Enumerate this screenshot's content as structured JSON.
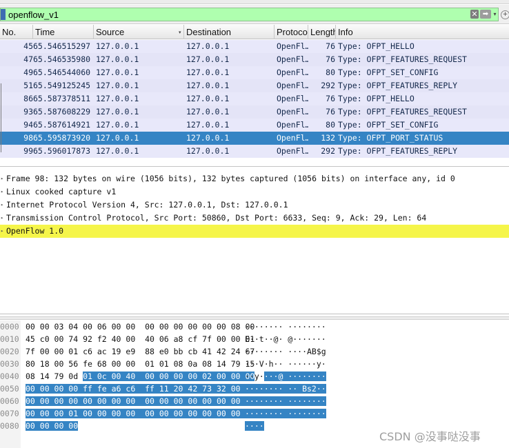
{
  "filter": {
    "value": "openflow_v1"
  },
  "icons": {
    "bookmark": "bookmark-icon",
    "clear": "✕",
    "apply": "➡",
    "dropdown": "▾",
    "add": "+",
    "sort": "▾",
    "expander": "▸",
    "hscroll_right": "▸"
  },
  "columns": [
    "No.",
    "Time",
    "Source",
    "Destination",
    "Protocol",
    "Length",
    "Info"
  ],
  "packets": [
    {
      "no": "45",
      "time": "65.546515297",
      "src": "127.0.0.1",
      "dst": "127.0.0.1",
      "proto": "OpenFl…",
      "len": "76",
      "info": "Type: OFPT_HELLO"
    },
    {
      "no": "47",
      "time": "65.546535980",
      "src": "127.0.0.1",
      "dst": "127.0.0.1",
      "proto": "OpenFl…",
      "len": "76",
      "info": "Type: OFPT_FEATURES_REQUEST"
    },
    {
      "no": "49",
      "time": "65.546544060",
      "src": "127.0.0.1",
      "dst": "127.0.0.1",
      "proto": "OpenFl…",
      "len": "80",
      "info": "Type: OFPT_SET_CONFIG"
    },
    {
      "no": "51",
      "time": "65.549125245",
      "src": "127.0.0.1",
      "dst": "127.0.0.1",
      "proto": "OpenFl…",
      "len": "292",
      "info": "Type: OFPT_FEATURES_REPLY"
    },
    {
      "no": "86",
      "time": "65.587378511",
      "src": "127.0.0.1",
      "dst": "127.0.0.1",
      "proto": "OpenFl…",
      "len": "76",
      "info": "Type: OFPT_HELLO"
    },
    {
      "no": "93",
      "time": "65.587608229",
      "src": "127.0.0.1",
      "dst": "127.0.0.1",
      "proto": "OpenFl…",
      "len": "76",
      "info": "Type: OFPT_FEATURES_REQUEST"
    },
    {
      "no": "94",
      "time": "65.587614921",
      "src": "127.0.0.1",
      "dst": "127.0.0.1",
      "proto": "OpenFl…",
      "len": "80",
      "info": "Type: OFPT_SET_CONFIG"
    },
    {
      "no": "98",
      "time": "65.595873920",
      "src": "127.0.0.1",
      "dst": "127.0.0.1",
      "proto": "OpenFl…",
      "len": "132",
      "info": "Type: OFPT_PORT_STATUS",
      "selected": true
    },
    {
      "no": "99",
      "time": "65.596017873",
      "src": "127.0.0.1",
      "dst": "127.0.0.1",
      "proto": "OpenFl…",
      "len": "292",
      "info": "Type: OFPT_FEATURES_REPLY"
    }
  ],
  "details": [
    {
      "text": "Frame 98: 132 bytes on wire (1056 bits), 132 bytes captured (1056 bits) on interface any, id 0"
    },
    {
      "text": "Linux cooked capture v1"
    },
    {
      "text": "Internet Protocol Version 4, Src: 127.0.0.1, Dst: 127.0.0.1"
    },
    {
      "text": "Transmission Control Protocol, Src Port: 50860, Dst Port: 6633, Seq: 9, Ack: 29, Len: 64"
    },
    {
      "text": "OpenFlow 1.0",
      "highlight": true
    }
  ],
  "bytes": [
    {
      "offset": "0000",
      "hex": "00 00 03 04 00 06 00 00  00 00 00 00 00 00 08 00",
      "ascii": "········ ········",
      "hl_from_byte": 16
    },
    {
      "offset": "0010",
      "hex": "45 c0 00 74 92 f2 40 00  40 06 a8 cf 7f 00 00 01",
      "ascii": "E··t··@· @·······",
      "hl_from_byte": 16
    },
    {
      "offset": "0020",
      "hex": "7f 00 00 01 c6 ac 19 e9  88 e0 bb cb 41 42 24 67",
      "ascii": "········ ····AB$g",
      "hl_from_byte": 16
    },
    {
      "offset": "0030",
      "hex": "80 18 00 56 fe 68 00 00  01 01 08 0a 08 14 79 15",
      "ascii": "···V·h·· ······y·",
      "hl_from_byte": 16
    },
    {
      "offset": "0040",
      "hex": "08 14 79 0d 01 0c 00 40  00 00 00 00 02 00 00 00",
      "ascii": "··y····@ ········",
      "hl_from_byte": 4
    },
    {
      "offset": "0050",
      "hex": "00 00 00 00 ff fe a6 c6  ff 11 20 42 73 32 00 00",
      "ascii": "········ ·· Bs2··",
      "hl_from_byte": 0
    },
    {
      "offset": "0060",
      "hex": "00 00 00 00 00 00 00 00  00 00 00 00 00 00 00 01",
      "ascii": "········ ········",
      "hl_from_byte": 0
    },
    {
      "offset": "0070",
      "hex": "00 00 00 01 00 00 00 00  00 00 00 00 00 00 00 00",
      "ascii": "········ ········",
      "hl_from_byte": 0
    },
    {
      "offset": "0080",
      "hex": "00 00 00 00",
      "ascii": "····",
      "hl_from_byte": 0
    }
  ],
  "watermark": "CSDN @没事哒没事",
  "colors": {
    "filter_valid_bg": "#afffaf",
    "selected_row": "#3584c4",
    "row_bg": "#e8e8fa",
    "highlight_yellow": "#f5f54a"
  }
}
